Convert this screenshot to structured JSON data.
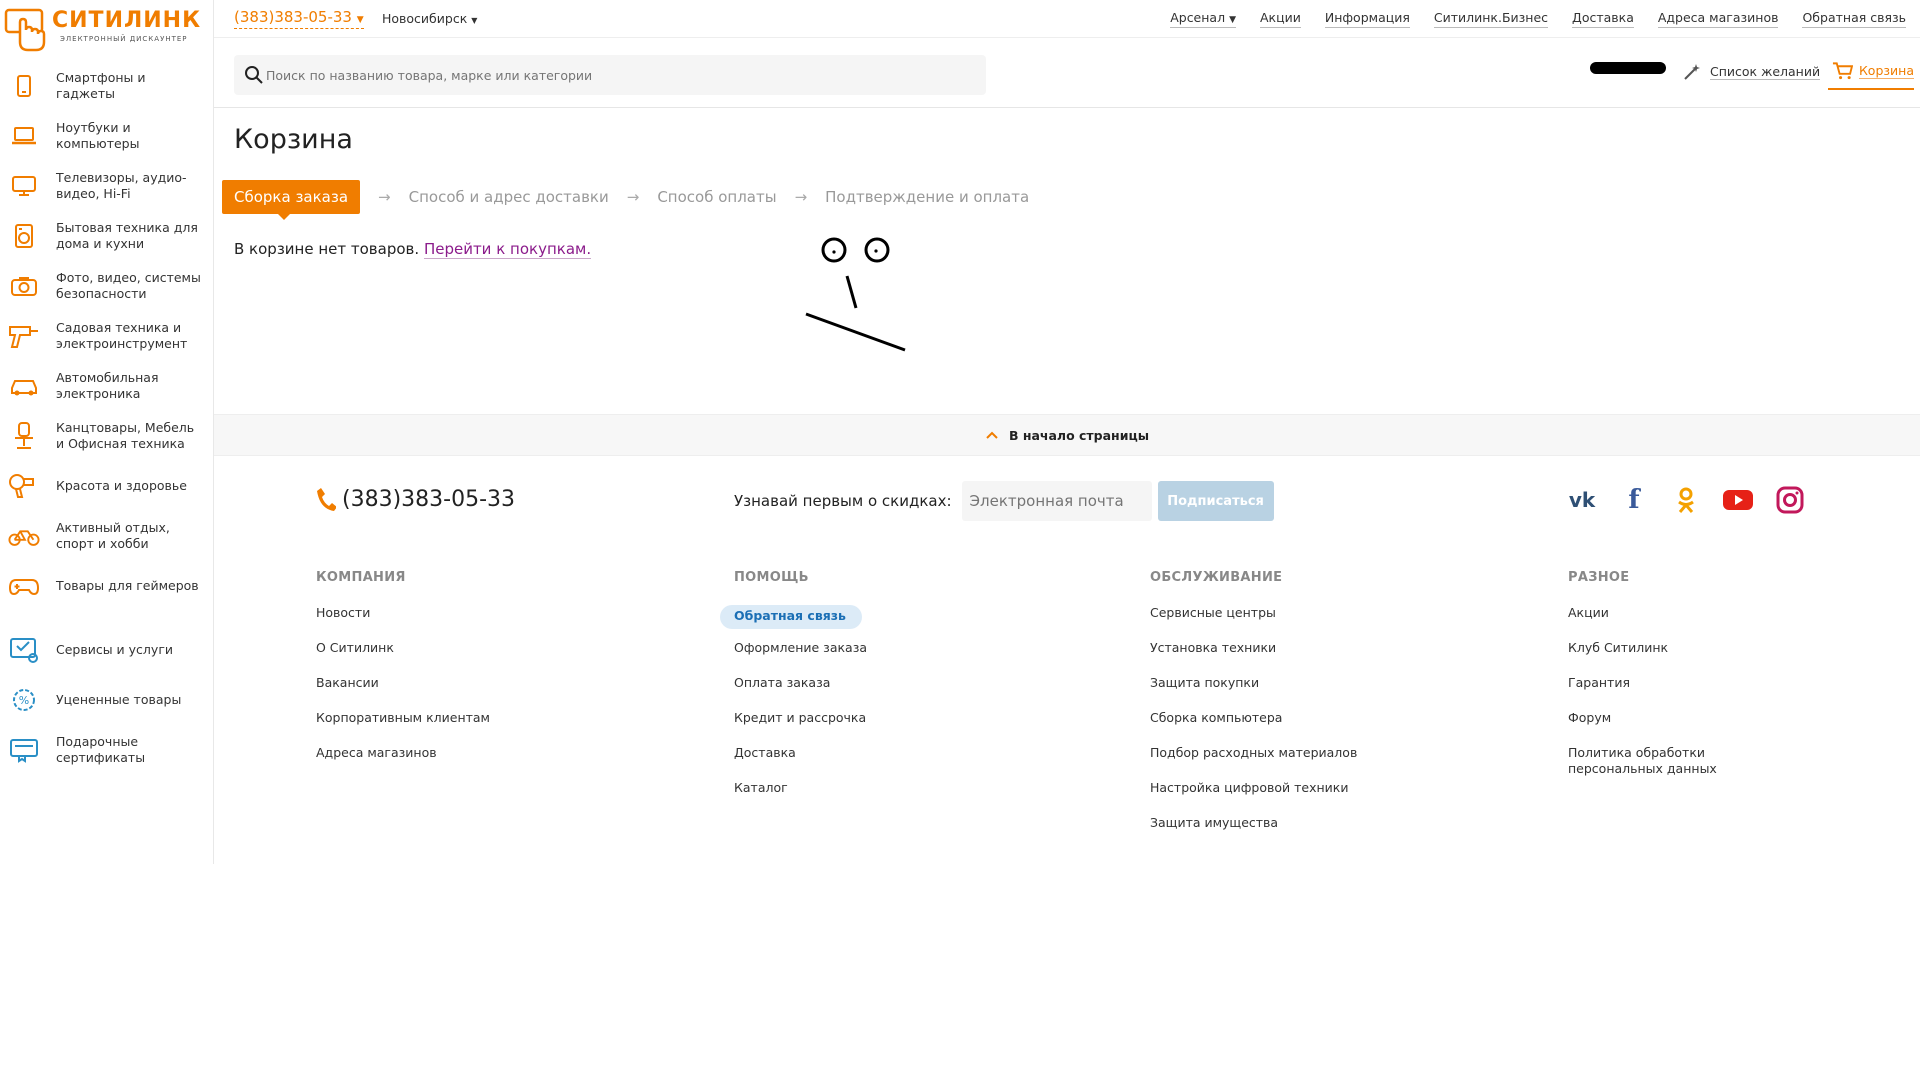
{
  "logo": {
    "brand": "СИТИЛИНК",
    "tagline": "ЭЛЕКТРОННЫЙ ДИСКАУНТЕР"
  },
  "sidebar": {
    "items": [
      {
        "label": "Смартфоны и гаджеты",
        "icon": "smartphone-icon"
      },
      {
        "label": "Ноутбуки и компьютеры",
        "icon": "laptop-icon"
      },
      {
        "label": "Телевизоры, аудио-видео, Hi-Fi",
        "icon": "monitor-icon"
      },
      {
        "label": "Бытовая техника для дома и кухни",
        "icon": "appliance-icon"
      },
      {
        "label": "Фото, видео, системы безопасности",
        "icon": "camera-icon"
      },
      {
        "label": "Садовая техника и электроинструмент",
        "icon": "drill-icon"
      },
      {
        "label": "Автомобильная электроника",
        "icon": "car-icon"
      },
      {
        "label": "Канцтовары, Мебель и Офисная техника",
        "icon": "office-chair-icon"
      },
      {
        "label": "Красота и здоровье",
        "icon": "hairdryer-icon"
      },
      {
        "label": "Активный отдых, спорт и хобби",
        "icon": "bicycle-icon"
      },
      {
        "label": "Товары для геймеров",
        "icon": "gamepad-icon"
      },
      {
        "label": "Сервисы и услуги",
        "icon": "services-icon"
      },
      {
        "label": "Уцененные товары",
        "icon": "discount-icon"
      },
      {
        "label": "Подарочные сертификаты",
        "icon": "gift-card-icon"
      }
    ]
  },
  "topbar": {
    "phone": "(383)383-05-33",
    "city": "Новосибирск",
    "links": [
      "Арсенал",
      "Акции",
      "Информация",
      "Ситилинк.Бизнес",
      "Доставка",
      "Адреса магазинов",
      "Обратная связь"
    ]
  },
  "header": {
    "search_placeholder": "Поиск по названию товара, марке или категории",
    "wishlist": "Список желаний",
    "cart": "Корзина"
  },
  "main": {
    "title": "Корзина",
    "steps": [
      "Сборка заказа",
      "Способ и адрес доставки",
      "Способ оплаты",
      "Подтверждение и оплата"
    ],
    "empty_text": "В корзине нет товаров.",
    "empty_link": "Перейти к покупкам."
  },
  "to_top": "В начало страницы",
  "footer": {
    "phone": "(383)383-05-33",
    "subscribe_label": "Узнавай первым о скидках:",
    "email_placeholder": "Электронная почта",
    "subscribe_button": "Подписаться",
    "socials": [
      "vk-icon",
      "facebook-icon",
      "odnoklassniki-icon",
      "youtube-icon",
      "instagram-icon"
    ],
    "columns": [
      {
        "heading": "КОМПАНИЯ",
        "items": [
          "Новости",
          "О Ситилинк",
          "Вакансии",
          "Корпоративным клиентам",
          "Адреса магазинов"
        ]
      },
      {
        "heading": "ПОМОЩЬ",
        "items": [
          "Обратная связь",
          "Оформление заказа",
          "Оплата заказа",
          "Кредит и рассрочка",
          "Доставка",
          "Каталог"
        ]
      },
      {
        "heading": "ОБСЛУЖИВАНИЕ",
        "items": [
          "Сервисные центры",
          "Установка техники",
          "Защита покупки",
          "Сборка компьютера",
          "Подбор расходных материалов",
          "Настройка цифровой техники",
          "Защита имущества"
        ]
      },
      {
        "heading": "РАЗНОЕ",
        "items": [
          "Акции",
          "Клуб Ситилинк",
          "Гарантия",
          "Форум",
          "Политика обработки персональных данных"
        ]
      }
    ]
  },
  "colors": {
    "accent": "#f07d00",
    "link": "#8b1b8b",
    "highlight": "#1b6fb5"
  }
}
